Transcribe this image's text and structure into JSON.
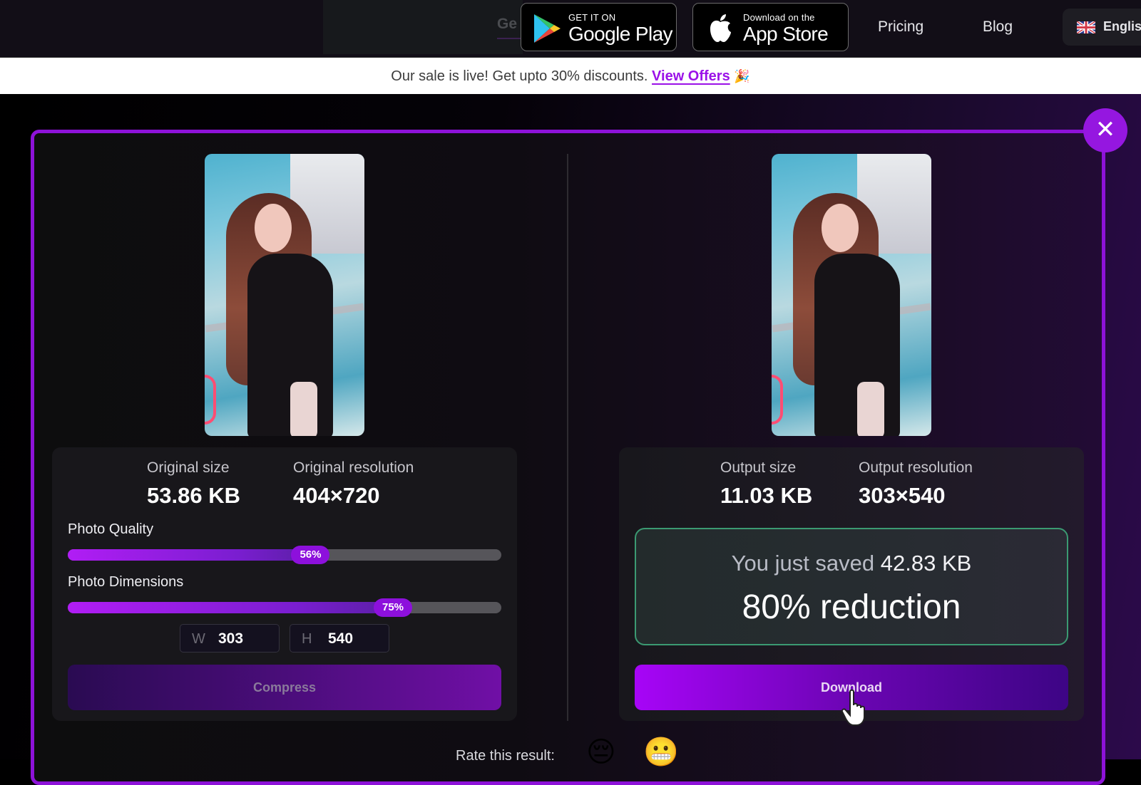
{
  "nav": {
    "ghost_text": "Ge",
    "google_play": {
      "small": "GET IT ON",
      "big": "Google Play"
    },
    "app_store": {
      "small": "Download on the",
      "big": "App Store"
    },
    "links": [
      {
        "label": "Pricing"
      },
      {
        "label": "Blog"
      }
    ],
    "language": {
      "label": "English",
      "flag_icon": "uk-flag-icon"
    }
  },
  "banner": {
    "text": "Our sale is live! Get upto 30% discounts.",
    "link_label": "View Offers",
    "emoji": "🎉"
  },
  "modal": {
    "close_label": "✕",
    "original": {
      "size_label": "Original size",
      "size_value": "53.86 KB",
      "resolution_label": "Original resolution",
      "resolution_value": "404×720"
    },
    "output": {
      "size_label": "Output size",
      "size_value": "11.03 KB",
      "resolution_label": "Output resolution",
      "resolution_value": "303×540"
    },
    "quality": {
      "label": "Photo Quality",
      "value_text": "56%",
      "value": 56
    },
    "dimensions": {
      "label": "Photo Dimensions",
      "value_text": "75%",
      "value": 75
    },
    "width_input": {
      "prefix": "W",
      "value": "303"
    },
    "height_input": {
      "prefix": "H",
      "value": "540"
    },
    "compress_label": "Compress",
    "saved": {
      "prefix": "You just saved",
      "amount": "42.83 KB",
      "reduction": "80% reduction"
    },
    "download_label": "Download",
    "rate": {
      "label": "Rate this result:",
      "options": [
        "😔",
        "😬"
      ]
    }
  },
  "colors": {
    "accent": "#9517e0",
    "border": "#8d12d8",
    "success_border": "#3b9a72"
  }
}
